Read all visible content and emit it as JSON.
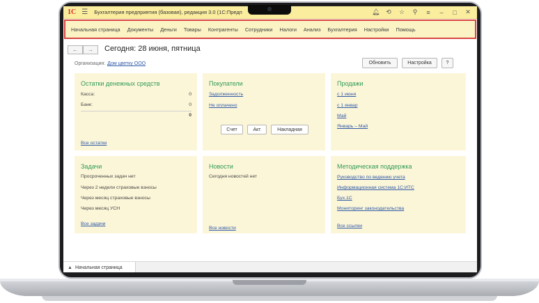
{
  "window": {
    "logo": "1С",
    "title": "Бухгалтерия предприятия (базовая), редакция 3.0  (1С:Предп",
    "icons": [
      "bell-icon",
      "history-icon",
      "star-icon",
      "search-icon",
      "settings-icon",
      "minimize-icon",
      "maximize-icon",
      "close-icon"
    ]
  },
  "menu": {
    "items": [
      "Начальная страница",
      "Документы",
      "Деньги",
      "Товары",
      "Контрагенты",
      "Сотрудники",
      "Налоги",
      "Анализ",
      "Бухгалтерия",
      "Настройки",
      "Помощь"
    ]
  },
  "header": {
    "back": "←",
    "forward": "→",
    "title": "Сегодня: 28 июня, пятница",
    "org_label": "Организация:",
    "org_value": "Дом цветку ООО",
    "refresh": "Обновить",
    "settings": "Настройка",
    "help": "?"
  },
  "panels": {
    "cash": {
      "title": "Остатки денежных средств",
      "rows": [
        {
          "label": "Касса:",
          "value": "0"
        },
        {
          "label": "Банк:",
          "value": "0"
        }
      ],
      "total": "0",
      "link": "Все остатки"
    },
    "buyers": {
      "title": "Покупатели",
      "links": [
        "Задолженность",
        "Не оплачено"
      ],
      "buttons": [
        "Счет",
        "Акт",
        "Накладная"
      ]
    },
    "sales": {
      "title": "Продажи",
      "links": [
        "с 1 июня",
        "с 1 январ",
        "Май",
        "Январь – Май"
      ]
    },
    "tasks": {
      "title": "Задачи",
      "items": [
        "Просроченных задач нет",
        "Через 2 недели страховые взносы",
        "Через месяц страховые взносы",
        "Через месяц УСН"
      ],
      "link": "Все задачи"
    },
    "news": {
      "title": "Новости",
      "text": "Сегодня новостей нет",
      "link": "Все новости"
    },
    "support": {
      "title": "Методическая поддержка",
      "links": [
        "Руководство по ведению учета",
        "Информационная система 1С:ИТС",
        "Бух.1С",
        "Мониторинг законодательства"
      ],
      "all": "Все ссылки"
    }
  },
  "tabstrip": {
    "active_tab": "Начальная страница"
  },
  "colors": {
    "titlebar": "#fbed9e",
    "menubar": "#fbf3c4",
    "highlight_border": "#d94343",
    "panel": "#fcf6d8",
    "panel_title": "#2f9a56",
    "link": "#2f5aa8"
  }
}
